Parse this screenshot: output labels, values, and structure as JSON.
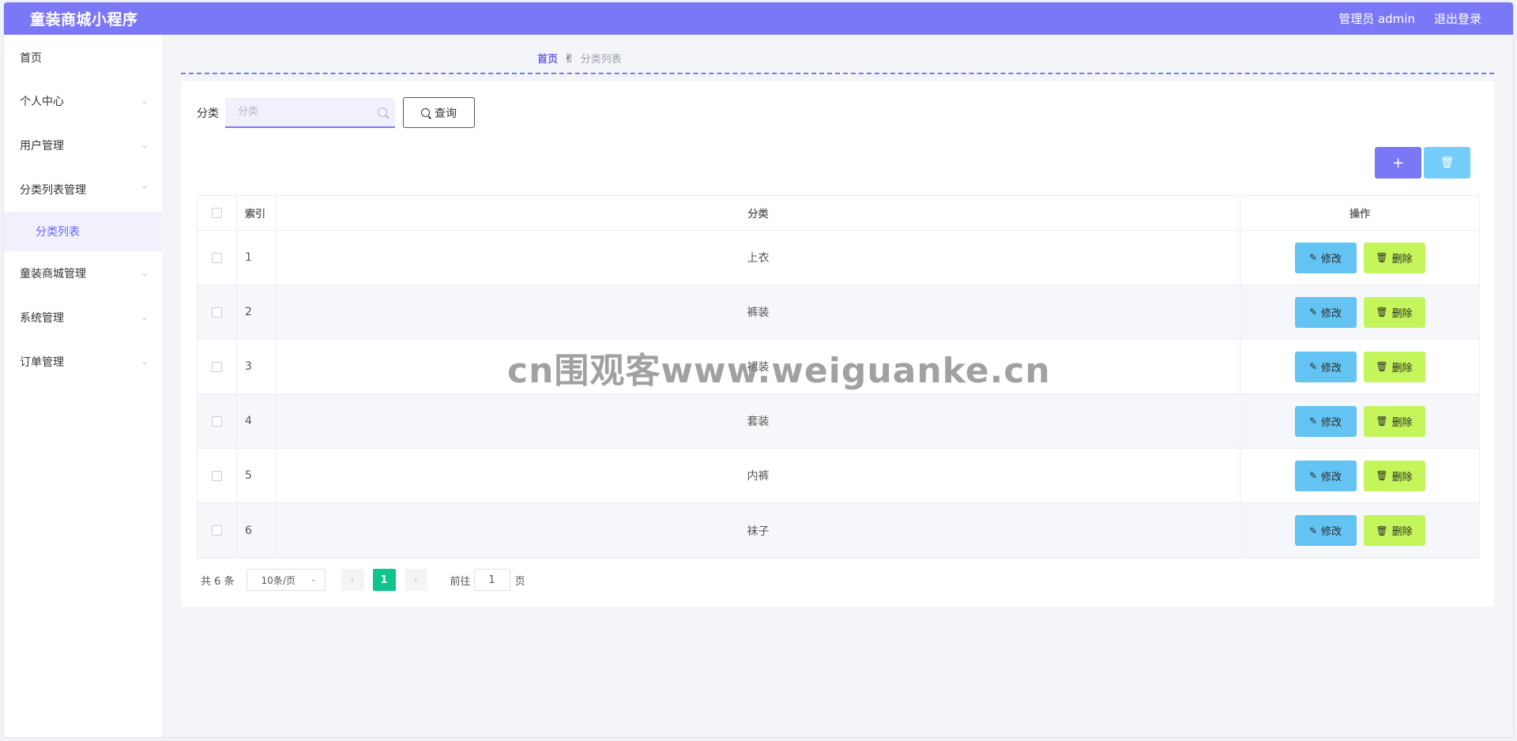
{
  "header": {
    "title": "童装商城小程序",
    "user": "管理员 admin",
    "logout": "退出登录",
    "color": "#7b78f7"
  },
  "sidebar": {
    "items": [
      {
        "label": "首页",
        "has_children": false
      },
      {
        "label": "个人中心",
        "has_children": true,
        "expanded": false
      },
      {
        "label": "用户管理",
        "has_children": true,
        "expanded": false
      },
      {
        "label": "分类列表管理",
        "has_children": true,
        "expanded": true
      },
      {
        "label": "童装商城管理",
        "has_children": true,
        "expanded": false
      },
      {
        "label": "系统管理",
        "has_children": true,
        "expanded": false
      },
      {
        "label": "订单管理",
        "has_children": true,
        "expanded": false
      }
    ],
    "active_subitem": "分类列表"
  },
  "breadcrumb": {
    "home": "首页",
    "separator_icon": "hand-icon",
    "current": "分类列表"
  },
  "search": {
    "label": "分类",
    "placeholder": "分类",
    "value": "",
    "button_label": "查询"
  },
  "toolbar": {
    "add_icon": "plus-icon",
    "delete_icon": "trash-icon"
  },
  "table": {
    "columns": [
      "索引",
      "分类",
      "操作"
    ],
    "rows": [
      {
        "index": "1",
        "category": "上衣"
      },
      {
        "index": "2",
        "category": "裤装"
      },
      {
        "index": "3",
        "category": "裙装"
      },
      {
        "index": "4",
        "category": "套装"
      },
      {
        "index": "5",
        "category": "内裤"
      },
      {
        "index": "6",
        "category": "袜子"
      }
    ],
    "edit_label": "修改",
    "delete_label": "删除"
  },
  "pagination": {
    "total": "共 6 条",
    "page_size": "10条/页",
    "current_page": "1",
    "goto_label": "前往",
    "goto_value": "1",
    "page_suffix": "页"
  },
  "watermark": "cn围观客www.weiguanke.cn"
}
